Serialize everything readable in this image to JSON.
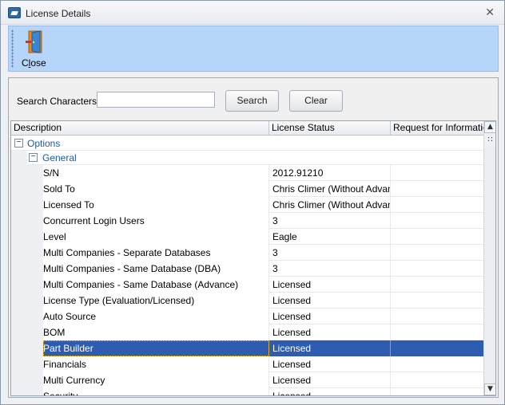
{
  "window": {
    "title": "License Details",
    "close_glyph": "✕"
  },
  "toolbar": {
    "close_label_pre": "C",
    "close_label_under": "l",
    "close_label_post": "ose"
  },
  "search": {
    "label": "Search Characters :",
    "value": "",
    "placeholder": "",
    "search_button": "Search",
    "clear_button": "Clear"
  },
  "grid": {
    "columns": [
      "Description",
      "License Status",
      "Request for Information"
    ],
    "group": "Options",
    "subgroup": "General",
    "rows": [
      {
        "description": "S/N",
        "status": "2012.91210",
        "request": ""
      },
      {
        "description": "Sold To",
        "status": "Chris Climer (Without Advance",
        "request": ""
      },
      {
        "description": "Licensed To",
        "status": "Chris Climer (Without Advance",
        "request": ""
      },
      {
        "description": "Concurrent Login Users",
        "status": "3",
        "request": ""
      },
      {
        "description": "Level",
        "status": "Eagle",
        "request": ""
      },
      {
        "description": "Multi Companies - Separate Databases",
        "status": "3",
        "request": ""
      },
      {
        "description": "Multi Companies - Same Database (DBA)",
        "status": "3",
        "request": ""
      },
      {
        "description": "Multi Companies - Same Database (Advance)",
        "status": "Licensed",
        "request": ""
      },
      {
        "description": "License Type (Evaluation/Licensed)",
        "status": "Licensed",
        "request": ""
      },
      {
        "description": "Auto Source",
        "status": "Licensed",
        "request": ""
      },
      {
        "description": "BOM",
        "status": "Licensed",
        "request": ""
      },
      {
        "description": "Part Builder",
        "status": "Licensed",
        "request": ""
      },
      {
        "description": "Financials",
        "status": "Licensed",
        "request": ""
      },
      {
        "description": "Multi Currency",
        "status": "Licensed",
        "request": ""
      },
      {
        "description": "Security",
        "status": "Licensed",
        "request": ""
      }
    ],
    "selected_row": "Part Builder"
  },
  "scrollbar": {
    "up_glyph": "▲",
    "down_glyph": "▼",
    "top_marker": "∷"
  },
  "colors": {
    "ribbon": "#b6d5fb",
    "selection": "#2e5cb0",
    "group_text": "#1c5aa6"
  }
}
